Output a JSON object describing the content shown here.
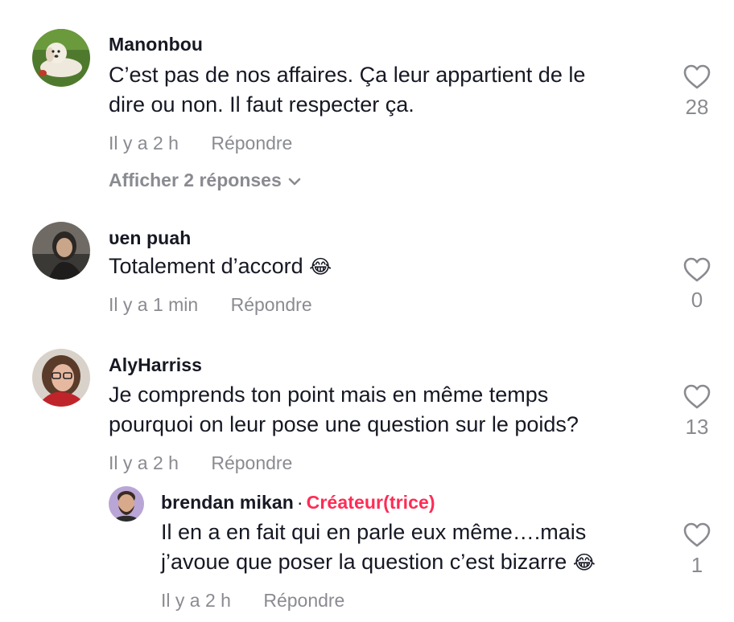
{
  "comments": [
    {
      "username": "Manonbou",
      "lines": [
        "C’est pas de nos affaires. Ça leur appartient de le",
        "dire ou non. Il faut respecter ça."
      ],
      "time": "Il y a 2 h",
      "reply_label": "Répondre",
      "likes": "28",
      "view_replies": "Afficher 2 réponses",
      "avatar_icon": "dog-photo"
    },
    {
      "username": "υen  puah",
      "lines": [
        "Totalement d’accord"
      ],
      "emoji": "😂",
      "time": "Il y a 1 min",
      "reply_label": "Répondre",
      "likes": "0",
      "avatar_icon": "person-photo-dark"
    },
    {
      "username": "AlyHarriss",
      "lines": [
        "Je comprends ton point mais en même temps",
        "pourquoi on leur pose une question sur le poids?"
      ],
      "time": "Il y a 2 h",
      "reply_label": "Répondre",
      "likes": "13",
      "avatar_icon": "person-photo-glasses"
    }
  ],
  "reply": {
    "username": "brendan mikan",
    "separator": "·",
    "creator_label": "Créateur(trice)",
    "lines": [
      "Il en a en fait qui en parle eux même….mais",
      "j’avoue que poser la question c’est bizarre"
    ],
    "emoji": "😂",
    "time": "Il y a 2 h",
    "reply_label": "Répondre",
    "likes": "1",
    "avatar_icon": "person-photo-bearded"
  },
  "colors": {
    "text": "#161823",
    "muted": "#8a8b91",
    "creator": "#fe2c55"
  }
}
